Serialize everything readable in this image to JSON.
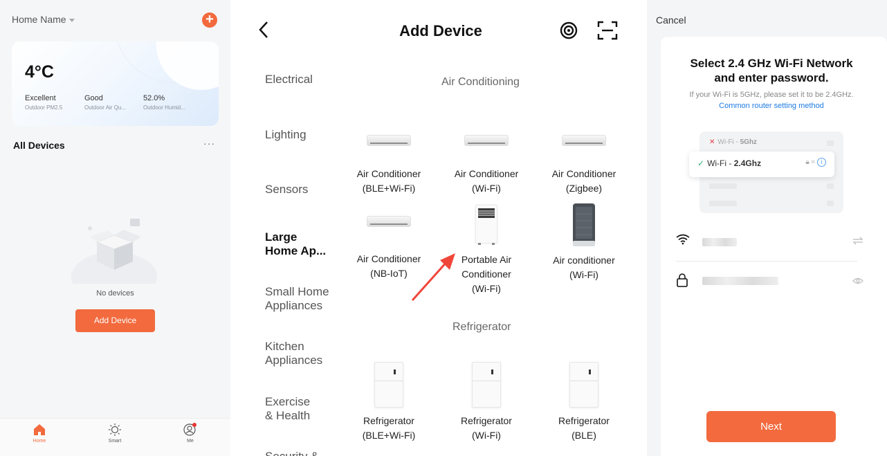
{
  "home": {
    "home_name": "Home Name",
    "temperature": "4°C",
    "stats": [
      {
        "value": "Excellent",
        "label": "Outdoor PM2.5"
      },
      {
        "value": "Good",
        "label": "Outdoor Air Qu..."
      },
      {
        "value": "52.0%",
        "label": "Outdoor Humid..."
      }
    ],
    "all_devices": "All Devices",
    "more": "···",
    "no_devices": "No devices",
    "add_device_button": "Add Device",
    "tabs": [
      {
        "label": "Home",
        "icon": "home-icon",
        "active": true
      },
      {
        "label": "Smart",
        "icon": "sun-icon",
        "active": false
      },
      {
        "label": "Me",
        "icon": "profile-icon",
        "active": false
      }
    ],
    "accent": "#f26a3d"
  },
  "add_device": {
    "title": "Add Device",
    "categories": [
      {
        "label": "Electrical",
        "active": false
      },
      {
        "label": "Lighting",
        "active": false
      },
      {
        "label": "Sensors",
        "active": false
      },
      {
        "label": "Large\nHome Ap...",
        "active": true
      },
      {
        "label": "Small Home\nAppliances",
        "active": false
      },
      {
        "label": "Kitchen\nAppliances",
        "active": false
      },
      {
        "label": "Exercise\n& Health",
        "active": false
      },
      {
        "label": "Security &",
        "active": false
      }
    ],
    "sections": {
      "air_conditioning": "Air Conditioning",
      "refrigerator": "Refrigerator"
    },
    "ac_devices": [
      {
        "line1": "Air Conditioner",
        "line2": "(BLE+Wi-Fi)",
        "line3": ""
      },
      {
        "line1": "Air Conditioner",
        "line2": "(Wi-Fi)",
        "line3": ""
      },
      {
        "line1": "Air Conditioner",
        "line2": "(Zigbee)",
        "line3": ""
      },
      {
        "line1": "Air Conditioner",
        "line2": "(NB-IoT)",
        "line3": ""
      },
      {
        "line1": "Portable Air",
        "line2": "Conditioner",
        "line3": "(Wi-Fi)"
      },
      {
        "line1": "Air conditioner",
        "line2": "(Wi-Fi)",
        "line3": ""
      }
    ],
    "fridge_devices": [
      {
        "line1": "Refrigerator",
        "line2": "(BLE+Wi-Fi)"
      },
      {
        "line1": "Refrigerator",
        "line2": "(Wi-Fi)"
      },
      {
        "line1": "Refrigerator",
        "line2": "(BLE)"
      }
    ]
  },
  "wifi": {
    "cancel": "Cancel",
    "heading_line1": "Select 2.4 GHz Wi-Fi Network",
    "heading_line2": "and enter password.",
    "subtext": "If your Wi-Fi is 5GHz, please set it to be 2.4GHz.",
    "link": "Common router setting method",
    "wifi_5g_prefix": "Wi-Fi - ",
    "wifi_5g_band": "5Ghz",
    "wifi_24_prefix": "Wi-Fi - ",
    "wifi_24_band": "2.4Ghz",
    "next_button": "Next"
  }
}
